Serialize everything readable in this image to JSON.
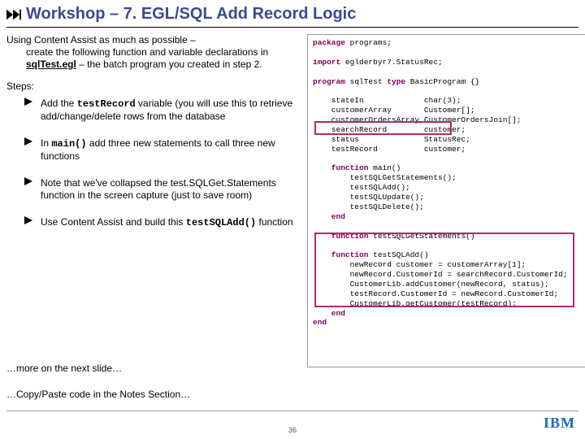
{
  "title": "Workshop – 7. EGL/SQL Add Record Logic",
  "intro_line1": "Using Content Assist as much as possible –",
  "intro_rest_a": "create the following function and variable declarations in ",
  "intro_bold": "sqlTest.egl",
  "intro_rest_b": " – the batch program you created in step 2.",
  "steps_label": "Steps:",
  "steps": [
    {
      "pre": "Add the ",
      "mono": "testRecord",
      "post": " variable (you will use this to retrieve add/change/delete rows from the database"
    },
    {
      "pre": "In ",
      "mono": "main()",
      "post": " add three new statements to call three new functions"
    },
    {
      "pre": "Note that we've collapsed the test.SQLGet.Statements function in the screen capture (just to save room)",
      "mono": "",
      "post": ""
    },
    {
      "pre": "Use Content Assist and build this ",
      "mono": "testSQLAdd()",
      "post": " function"
    }
  ],
  "more1": "…more on the next slide…",
  "more2": "…Copy/Paste code in the Notes Section…",
  "page_num": "36",
  "logo": "IBM",
  "code": {
    "l1a": "package",
    "l1b": " programs;",
    "l3a": "import",
    "l3b": " eglderbyr7.StatusRec;",
    "l5a": "program",
    "l5b": " sqlTest ",
    "l5c": "type",
    "l5d": " BasicProgram {}",
    "l7": "    stateIn             char(3);",
    "l8": "    customerArray       Customer[];",
    "l9": "    customerOrdersArray CustomerOrdersJoin[];",
    "l10": "    searchRecord        customer;",
    "l11": "    status              StatusRec;",
    "l12": "    testRecord          customer;",
    "l14a": "    function",
    "l14b": " main()",
    "l15": "        testSQLGetStatements();",
    "l16": "        testSQLAdd();",
    "l17": "        testSQLUpdate();",
    "l18": "        testSQLDelete();",
    "l19a": "    end",
    "l21a": "    function",
    "l21b": " testSQLGetStatements()",
    "l23a": "    function",
    "l23b": " testSQLAdd()",
    "l24": "        newRecord customer = customerArray[1];",
    "l25": "        newRecord.CustomerId = searchRecord.CustomerId;",
    "l26": "        CustomerLib.addCustomer(newRecord, status);",
    "l27": "        testRecord.CustomerId = newRecord.CustomerId;",
    "l28": "        CustomerLib.getCustomer(testRecord);",
    "l29a": "    end",
    "l30a": "end"
  }
}
